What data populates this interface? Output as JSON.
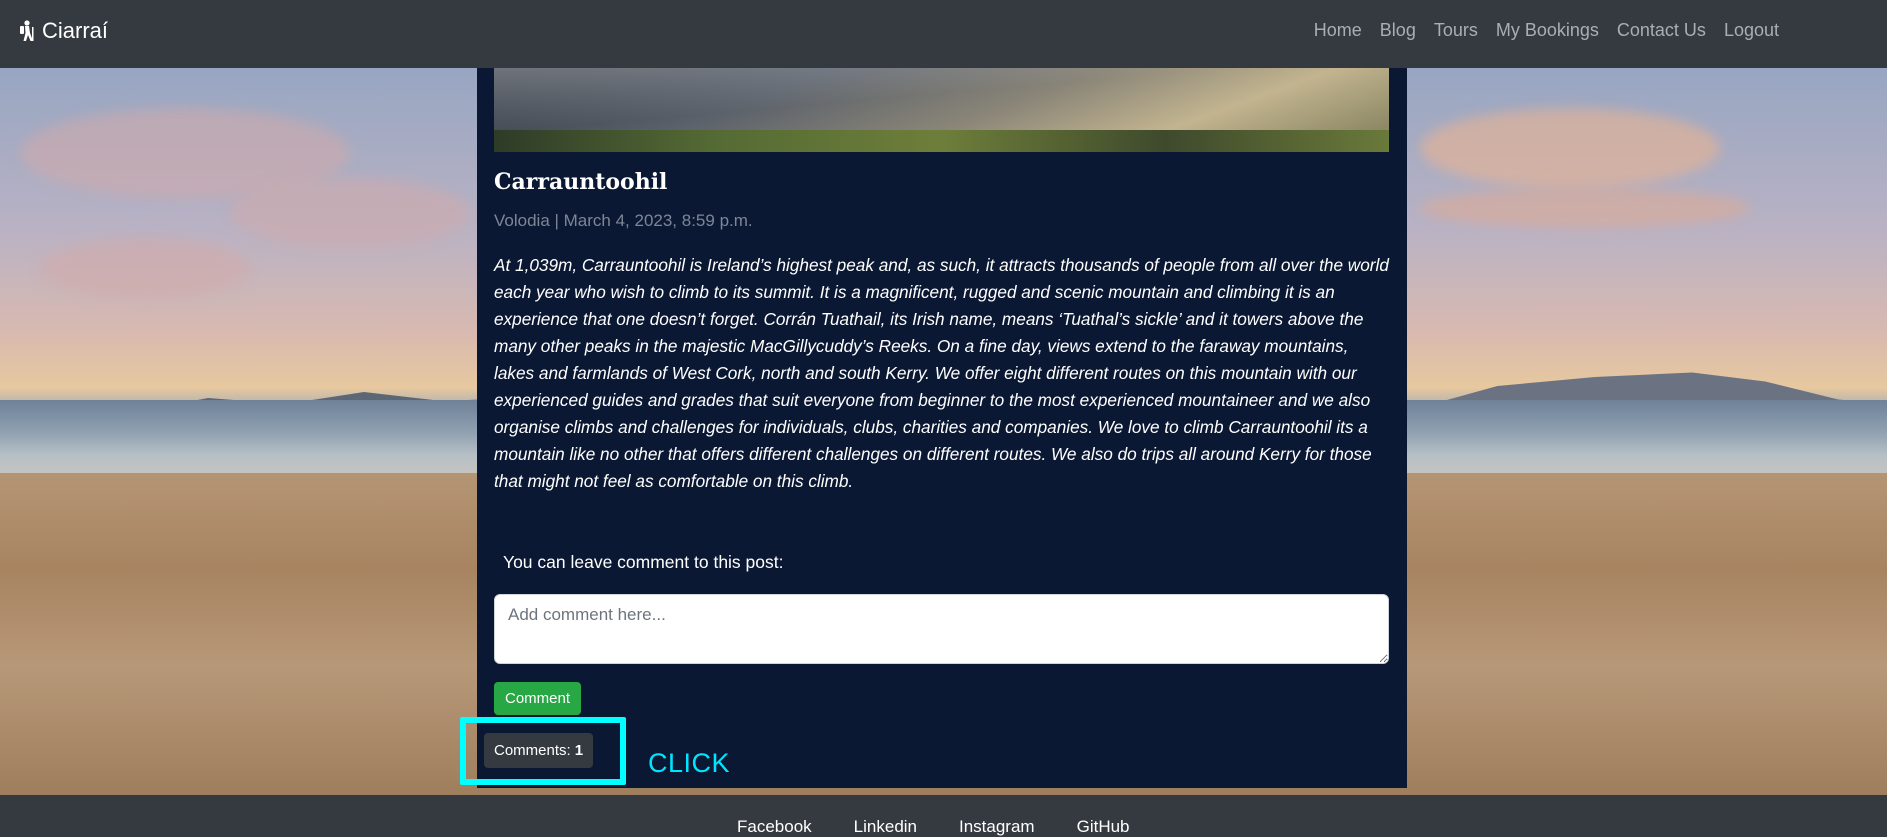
{
  "navbar": {
    "brand": "Ciarraí",
    "links": [
      "Home",
      "Blog",
      "Tours",
      "My Bookings",
      "Contact Us",
      "Logout"
    ]
  },
  "post": {
    "title": "Carrauntoohil",
    "meta": "Volodia | March 4, 2023, 8:59 p.m.",
    "body": "At 1,039m, Carrauntoohil is Ireland’s highest peak and, as such, it attracts thousands of people from all over the world each year who wish to climb to its summit. It is a magnificent, rugged and scenic mountain and climbing it is an experience that one doesn’t forget. Corrán Tuathail, its Irish name, means ‘Tuathal’s sickle’ and it towers above the many other peaks in the majestic MacGillycuddy’s Reeks. On a fine day, views extend to the faraway mountains, lakes and farmlands of West Cork, north and south Kerry. We offer eight different routes on this mountain with our experienced guides and grades that suit everyone from beginner to the most experienced mountaineer and we also organise climbs and challenges for individuals, clubs, charities and companies. We love to climb Carrauntoohil its a mountain like no other that offers different challenges on different routes. We also do trips all around Kerry for those that might not feel as comfortable on this climb."
  },
  "comment_form": {
    "prompt": "You can leave comment to this post:",
    "placeholder": "Add comment here...",
    "value": "",
    "submit_label": "Comment"
  },
  "comments": {
    "label": "Comments:",
    "count": "1"
  },
  "annotation": {
    "label": "CLICK",
    "color": "#00ffff"
  },
  "footer": {
    "links": [
      "Facebook",
      "Linkedin",
      "Instagram",
      "GitHub"
    ]
  },
  "colors": {
    "navbar": "#343a40",
    "card": "#0b1833",
    "accent_green": "#28a745"
  }
}
